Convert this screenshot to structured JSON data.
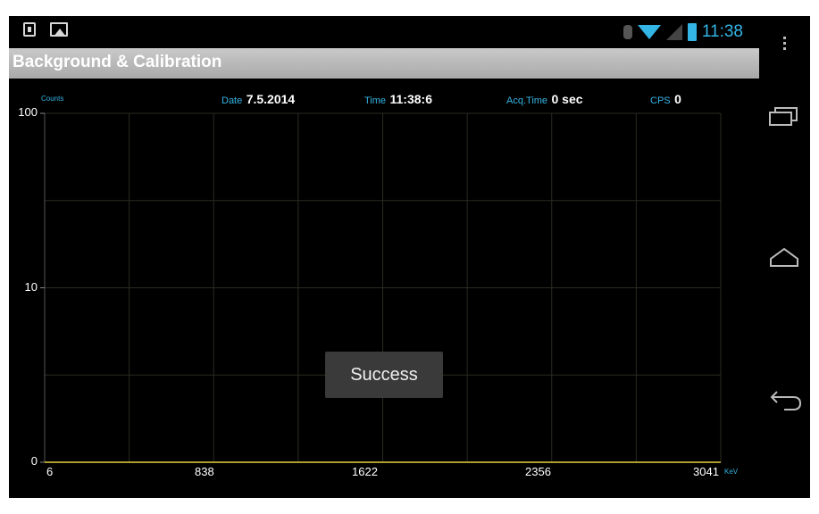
{
  "status_bar": {
    "time": "11:38",
    "icons": [
      "download-icon",
      "image-icon",
      "bluetooth-icon",
      "wifi-icon",
      "signal-icon",
      "battery-icon"
    ]
  },
  "action_bar": {
    "title": "Background & Calibration"
  },
  "header": {
    "counts_label": "Counts",
    "date_label": "Date",
    "date_value": "7.5.2014",
    "time_label": "Time",
    "time_value": "11:38:6",
    "acq_label": "Acq.Time",
    "acq_value": "0 sec",
    "cps_label": "CPS",
    "cps_value": "0"
  },
  "chart_data": {
    "type": "line",
    "ylabel": "Counts",
    "xlabel": "KeV",
    "y_scale": "log",
    "y_ticks": [
      "100",
      "10",
      "0"
    ],
    "x_ticks": [
      "6",
      "838",
      "1622",
      "2356",
      "3041"
    ],
    "grid": true,
    "series": [
      {
        "color": "#e6d23a",
        "x": [
          6,
          3041
        ],
        "y": [
          0,
          0
        ]
      }
    ]
  },
  "toast": {
    "message": "Success"
  },
  "nav": {
    "items": [
      "overflow-menu-icon",
      "recent-apps-icon",
      "home-icon",
      "back-icon"
    ]
  },
  "colors": {
    "accent": "#33b5e5",
    "grid": "#2a2a22",
    "trace": "#e6d23a",
    "action_bar": "#b8b8b8"
  }
}
